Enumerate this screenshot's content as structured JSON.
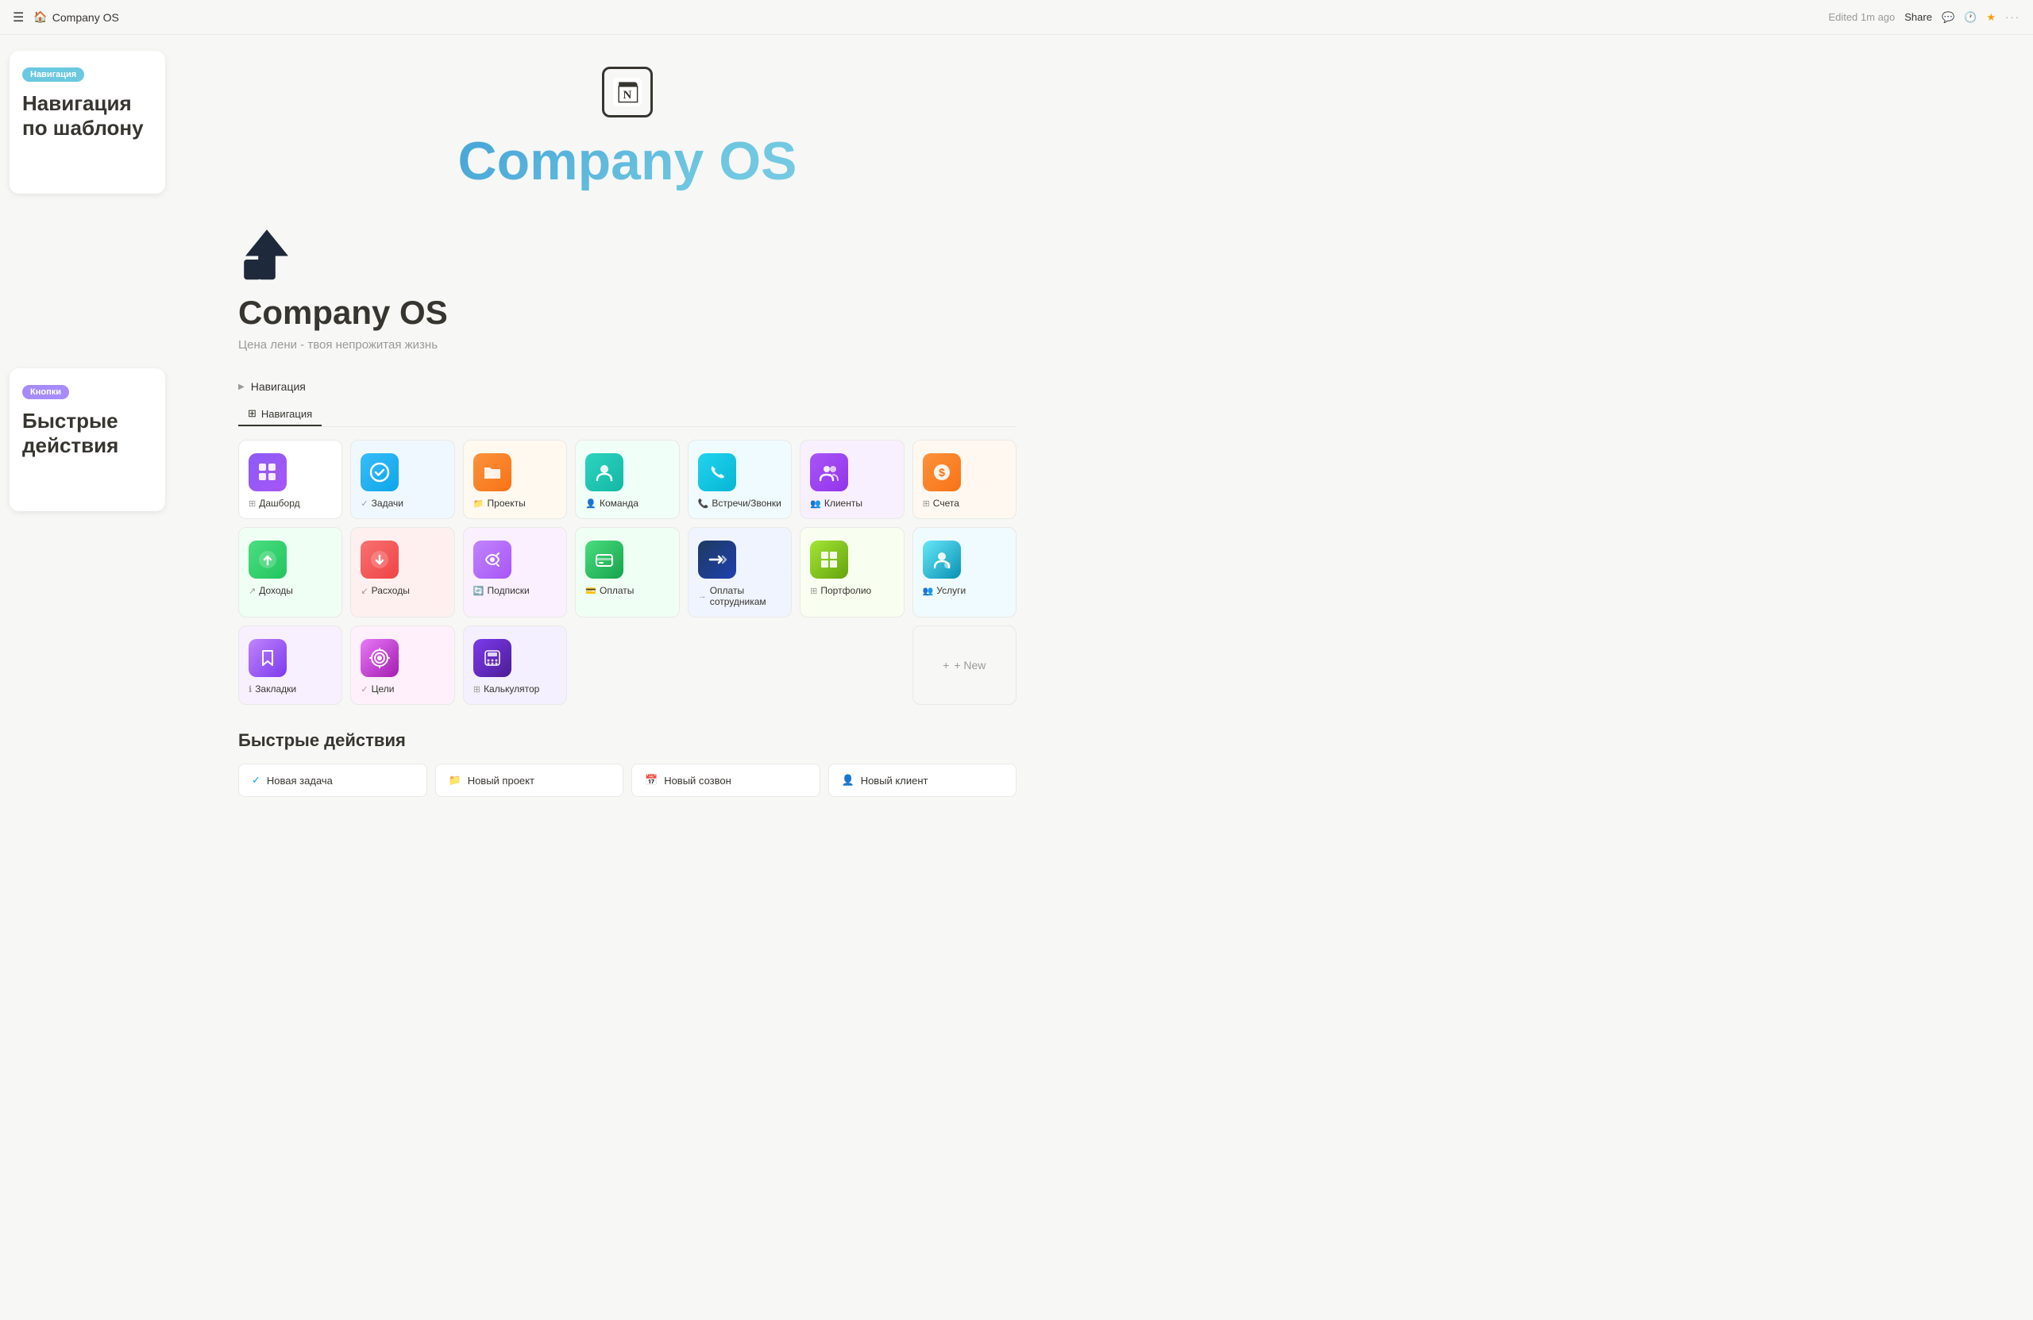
{
  "topbar": {
    "menu_icon": "☰",
    "home_icon": "🏠",
    "title": "Company OS",
    "edited": "Edited 1m ago",
    "share_label": "Share",
    "comment_icon": "💬",
    "clock_icon": "🕐",
    "star_icon": "⭐",
    "more_icon": "···"
  },
  "sidebar_hints": [
    {
      "id": "nav-hint",
      "badge": "Навигация",
      "badge_class": "nav",
      "title": "Навигация по шаблону"
    },
    {
      "id": "quick-hint",
      "badge": "Кнопки",
      "badge_class": "quick",
      "title": "Быстрые действия"
    }
  ],
  "center_header": {
    "logo_letter": "N",
    "title": "Company OS"
  },
  "page": {
    "title": "Company OS",
    "subtitle": "Цена лени - твоя непрожитая жизнь"
  },
  "navigation": {
    "section_label": "Навигация",
    "tab_label": "Навигация",
    "tab_icon": "⊞"
  },
  "cards_row1": [
    {
      "id": "dashboard",
      "icon": "⊞",
      "bg": "bg-purple",
      "label": "Дашборд",
      "label_icon": "⊞"
    },
    {
      "id": "tasks",
      "icon": "✅",
      "bg": "bg-blue",
      "label": "Задачи",
      "label_icon": "✓"
    },
    {
      "id": "projects",
      "icon": "📁",
      "bg": "bg-orange",
      "label": "Проекты",
      "label_icon": "📁"
    },
    {
      "id": "team",
      "icon": "👤",
      "bg": "bg-teal",
      "label": "Команда",
      "label_icon": "👤"
    },
    {
      "id": "meetings",
      "icon": "📞",
      "bg": "bg-phone",
      "label": "Встречи/Звонки",
      "label_icon": "📞"
    },
    {
      "id": "clients",
      "icon": "👥",
      "bg": "bg-team",
      "label": "Клиенты",
      "label_icon": "👥"
    },
    {
      "id": "accounts",
      "icon": "💰",
      "bg": "bg-money",
      "label": "Счета",
      "label_icon": "⊞"
    }
  ],
  "cards_row2": [
    {
      "id": "income",
      "icon": "↑",
      "bg": "bg-green-up",
      "label": "Доходы",
      "label_icon": "↗"
    },
    {
      "id": "expenses",
      "icon": "↓",
      "bg": "bg-red-down",
      "label": "Расходы",
      "label_icon": "↙"
    },
    {
      "id": "subscriptions",
      "icon": "🔄",
      "bg": "bg-purple-clock",
      "label": "Подписки",
      "label_icon": "🔄"
    },
    {
      "id": "payments",
      "icon": "💳",
      "bg": "bg-green-chart",
      "label": "Оплаты",
      "label_icon": "💳"
    },
    {
      "id": "salary",
      "icon": "→",
      "bg": "bg-dark-arrow",
      "label": "Оплаты сотрудникам",
      "label_icon": "→"
    },
    {
      "id": "portfolio",
      "icon": "⊞",
      "bg": "bg-windows",
      "label": "Портфолио",
      "label_icon": "⊞"
    },
    {
      "id": "services",
      "icon": "👤",
      "bg": "bg-cyan-user",
      "label": "Услуги",
      "label_icon": "👥"
    }
  ],
  "cards_row3": [
    {
      "id": "bookmarks",
      "icon": "🔖",
      "bg": "bg-purple-bookmark",
      "label": "Закладки",
      "label_icon": "ℹ"
    },
    {
      "id": "goals",
      "icon": "🎯",
      "bg": "bg-fuchsia-target",
      "label": "Цели",
      "label_icon": "✓"
    },
    {
      "id": "calculator",
      "icon": "⊞",
      "bg": "bg-dark-grid",
      "label": "Калькулятор",
      "label_icon": "⊞"
    }
  ],
  "new_button": "+ New",
  "quick_actions": {
    "title": "Быстрые действия",
    "buttons": [
      {
        "id": "new-task",
        "icon": "✓",
        "label": "Новая задача"
      },
      {
        "id": "new-project",
        "icon": "📁",
        "label": "Новый проект"
      },
      {
        "id": "new-call",
        "icon": "📅",
        "label": "Новый созвон"
      },
      {
        "id": "new-client",
        "icon": "👤",
        "label": "Новый клиент"
      }
    ]
  }
}
